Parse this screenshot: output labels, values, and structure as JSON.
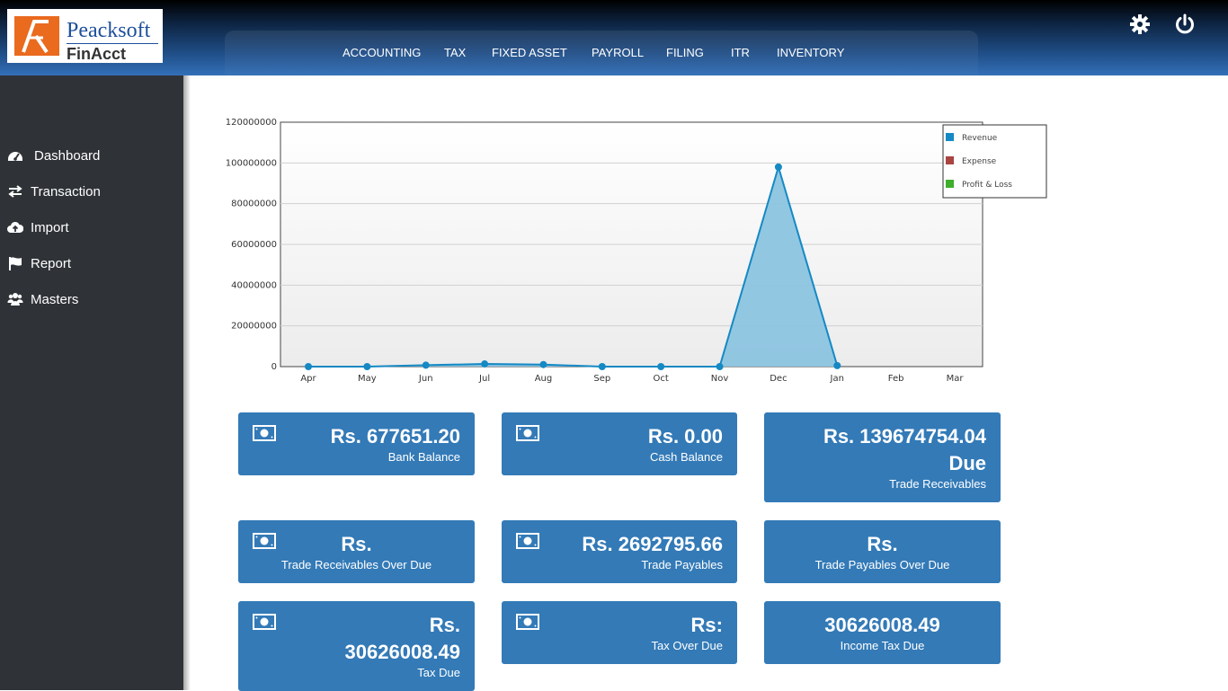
{
  "header": {
    "logo_brand": "Peacksoft",
    "logo_sub": "FinAcct",
    "nav": [
      "ACCOUNTING",
      "TAX",
      "FIXED ASSET",
      "PAYROLL",
      "FILING",
      "ITR",
      "INVENTORY"
    ],
    "settings_icon": "gear-icon",
    "power_icon": "power-icon"
  },
  "sidebar": {
    "items": [
      {
        "label": "Dashboard",
        "icon": "dashboard-icon"
      },
      {
        "label": "Transaction",
        "icon": "exchange-icon"
      },
      {
        "label": "Import",
        "icon": "cloud-upload-icon"
      },
      {
        "label": "Report",
        "icon": "flag-icon"
      },
      {
        "label": "Masters",
        "icon": "users-icon"
      }
    ]
  },
  "chart_data": {
    "type": "area",
    "categories": [
      "Apr",
      "May",
      "Jun",
      "Jul",
      "Aug",
      "Sep",
      "Oct",
      "Nov",
      "Dec",
      "Jan",
      "Feb",
      "Mar"
    ],
    "series": [
      {
        "name": "Revenue",
        "color": "#1589c4",
        "values": [
          0,
          0,
          700000,
          1300000,
          1000000,
          0,
          0,
          0,
          98000000,
          500000,
          null,
          null
        ]
      },
      {
        "name": "Expense",
        "color": "#a94442",
        "values": []
      },
      {
        "name": "Profit & Loss",
        "color": "#3fae2a",
        "values": []
      }
    ],
    "ylim": [
      0,
      120000000
    ],
    "yticks": [
      "0",
      "20000000",
      "40000000",
      "60000000",
      "80000000",
      "100000000",
      "120000000"
    ],
    "grid": true,
    "legend_position": "top-right"
  },
  "cards": [
    {
      "amount": "Rs. 677651.20",
      "label": "Bank Balance"
    },
    {
      "amount": "Rs. 0.00",
      "label": "Cash Balance"
    },
    {
      "amount_line1": "Rs. 139674754.04",
      "amount_line2": "Due",
      "label": "Trade Receivables"
    },
    {
      "amount": "Rs.",
      "label": "Trade Receivables Over Due"
    },
    {
      "amount": "Rs. 2692795.66",
      "label": "Trade Payables"
    },
    {
      "amount": "Rs.",
      "label": "Trade Payables Over Due"
    },
    {
      "amount_line1": "Rs.",
      "amount_line2": "30626008.49",
      "label": "Tax Due"
    },
    {
      "amount": "Rs:",
      "label": "Tax Over Due"
    },
    {
      "amount": "30626008.49",
      "label": "Income Tax Due"
    }
  ]
}
